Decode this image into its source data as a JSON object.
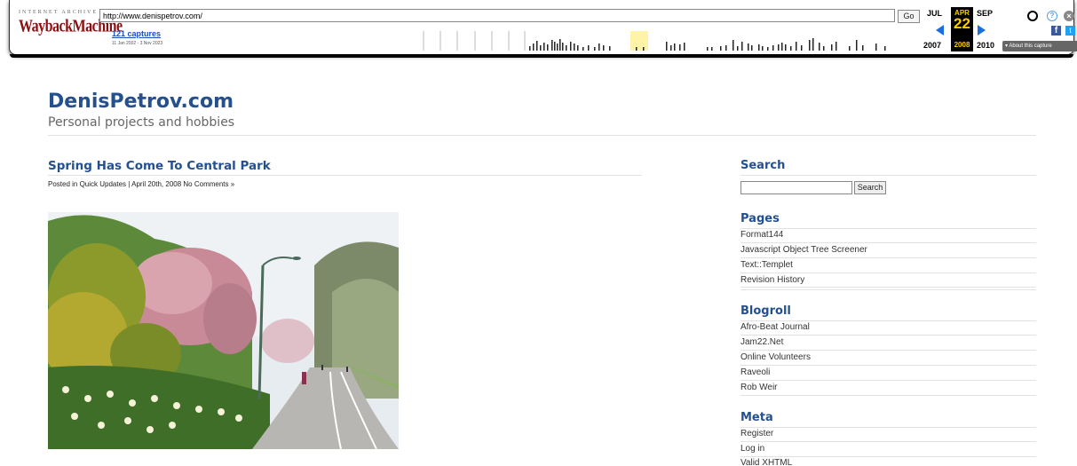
{
  "wayback": {
    "logo_top": "INTERNET ARCHIVE",
    "logo_main": "WaybackMachine",
    "url": "http://www.denispetrov.com/",
    "go_label": "Go",
    "captures_link": "121 captures",
    "date_range": "11 Jan 2002 - 3 Nov 2023",
    "prev_month": "JUL",
    "cur_month": "APR",
    "next_month": "SEP",
    "cur_day": "22",
    "prev_year": "2007",
    "cur_year": "2008",
    "next_year": "2010",
    "about_label": "About this capture",
    "icons": {
      "user": "user-icon",
      "help": "help-icon",
      "close": "close-icon",
      "facebook": "facebook-icon",
      "twitter": "twitter-icon"
    },
    "accent": "#ffcc00"
  },
  "site": {
    "title": "DenisPetrov.com",
    "description": "Personal projects and hobbies"
  },
  "post": {
    "title": "Spring Has Come To Central Park",
    "meta": "Posted in Quick Updates | April 20th, 2008 No Comments »"
  },
  "sidebar": {
    "search_heading": "Search",
    "search_button": "Search",
    "search_value": "",
    "pages_heading": "Pages",
    "pages": [
      "Format144",
      "Javascript Object Tree Screener",
      "Text::Templet",
      "Revision History"
    ],
    "blogroll_heading": "Blogroll",
    "blogroll": [
      "Afro-Beat Journal",
      "Jam22.Net",
      "Online Volunteers",
      "Raveoli",
      "Rob Weir"
    ],
    "meta_heading": "Meta",
    "meta": [
      "Register",
      "Log in",
      "Valid XHTML"
    ]
  },
  "colors": {
    "link": "#24508f",
    "rule": "#e2e2e2"
  }
}
